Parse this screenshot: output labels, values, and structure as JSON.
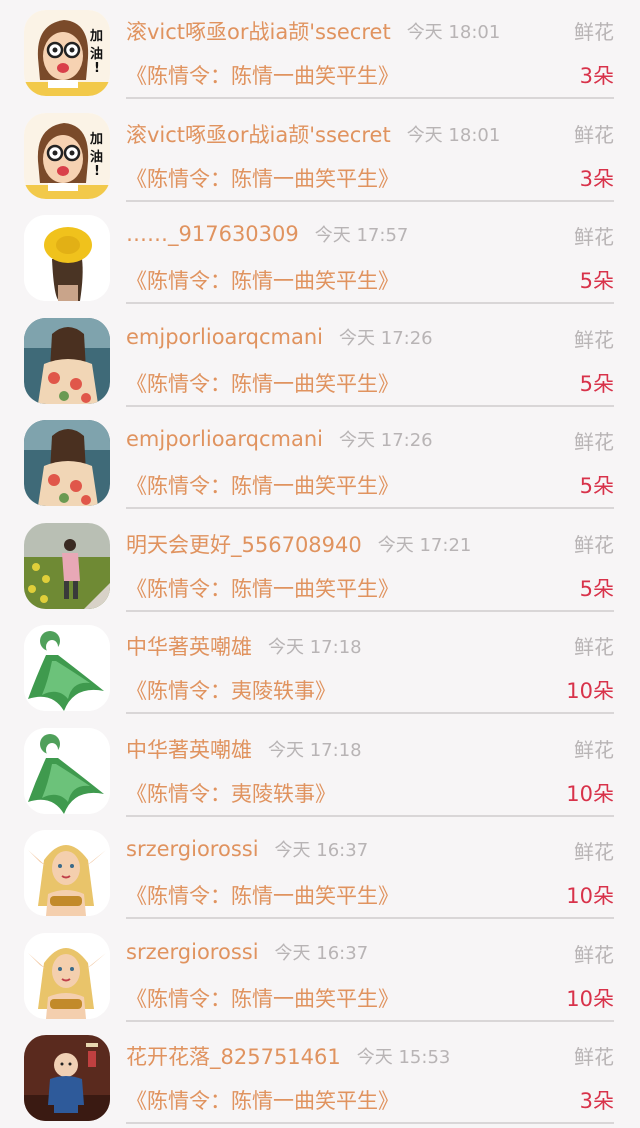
{
  "colors": {
    "background": "#f7f5f6",
    "username": "#e0935f",
    "time": "#b8b4b5",
    "count": "#d8324a",
    "divider": "#d9d6d7"
  },
  "items": [
    {
      "avatar": "cartoon-girl-avatar",
      "username": "滚vict啄亟or战ia颉'ssecret",
      "time": "今天 18:01",
      "gift": "鲜花",
      "book": "《陈情令：陈情一曲笑平生》",
      "count": "3朵"
    },
    {
      "avatar": "cartoon-girl-avatar",
      "username": "滚vict啄亟or战ia颉'ssecret",
      "time": "今天 18:01",
      "gift": "鲜花",
      "book": "《陈情令：陈情一曲笑平生》",
      "count": "3朵"
    },
    {
      "avatar": "yellow-hat-girl-avatar",
      "username": "……_917630309",
      "time": "今天 17:57",
      "gift": "鲜花",
      "book": "《陈情令：陈情一曲笑平生》",
      "count": "5朵"
    },
    {
      "avatar": "woman-back-avatar",
      "username": "emjporlioarqcmani",
      "time": "今天 17:26",
      "gift": "鲜花",
      "book": "《陈情令：陈情一曲笑平生》",
      "count": "5朵"
    },
    {
      "avatar": "woman-back-avatar",
      "username": "emjporlioarqcmani",
      "time": "今天 17:26",
      "gift": "鲜花",
      "book": "《陈情令：陈情一曲笑平生》",
      "count": "5朵"
    },
    {
      "avatar": "field-girl-avatar",
      "username": "明天会更好_556708940",
      "time": "今天 17:21",
      "gift": "鲜花",
      "book": "《陈情令：陈情一曲笑平生》",
      "count": "5朵"
    },
    {
      "avatar": "green-fairy-avatar",
      "username": "中华著英嘲雄",
      "time": "今天 17:18",
      "gift": "鲜花",
      "book": "《陈情令：夷陵轶事》",
      "count": "10朵"
    },
    {
      "avatar": "green-fairy-avatar",
      "username": "中华著英嘲雄",
      "time": "今天 17:18",
      "gift": "鲜花",
      "book": "《陈情令：夷陵轶事》",
      "count": "10朵"
    },
    {
      "avatar": "elf-warrior-avatar",
      "username": "srzergiorossi",
      "time": "今天 16:37",
      "gift": "鲜花",
      "book": "《陈情令：陈情一曲笑平生》",
      "count": "10朵"
    },
    {
      "avatar": "elf-warrior-avatar",
      "username": "srzergiorossi",
      "time": "今天 16:37",
      "gift": "鲜花",
      "book": "《陈情令：陈情一曲笑平生》",
      "count": "10朵"
    },
    {
      "avatar": "monk-figure-avatar",
      "username": "花开花落_825751461",
      "time": "今天 15:53",
      "gift": "鲜花",
      "book": "《陈情令：陈情一曲笑平生》",
      "count": "3朵"
    }
  ]
}
